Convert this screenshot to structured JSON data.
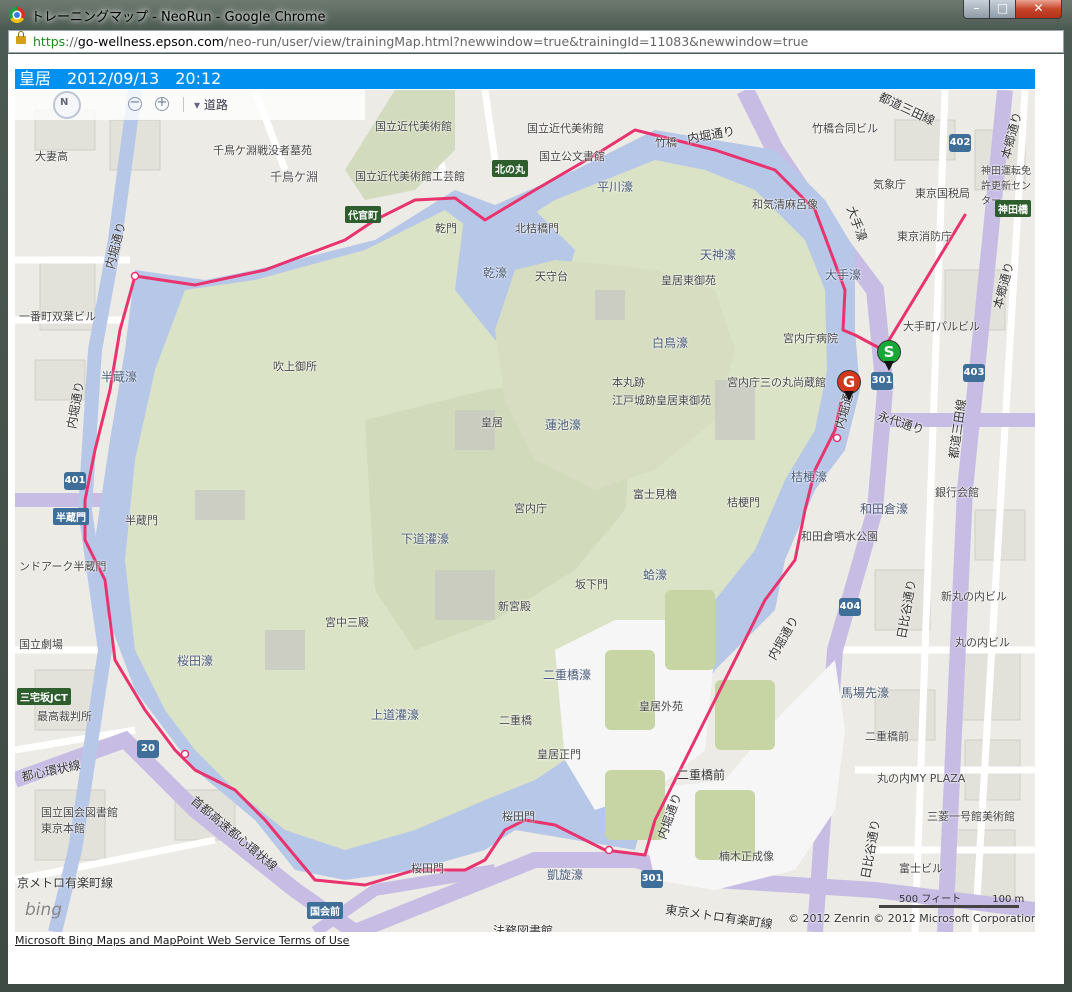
{
  "window": {
    "title": "トレーニングマップ - NeoRun - Google Chrome",
    "minimize": "–",
    "maximize": "□",
    "close": "✕"
  },
  "addressbar": {
    "scheme": "https",
    "host": "go-wellness.epson.com",
    "path": "/neo-run/user/view/trainingMap.html?newwindow=true&trainingId=11083&newwindow=true"
  },
  "header": {
    "title": "皇居　2012/09/13　20:12"
  },
  "map_controls": {
    "compass_label": "N",
    "zoom_out": "−",
    "zoom_in": "+",
    "map_style": "道路"
  },
  "markers": {
    "start": "S",
    "goal": "G"
  },
  "route_color": "#e8336f",
  "map_labels": {
    "chidorigafuchi": "千鳥ケ淵",
    "chidorigafuchi_cemetery": "千鳥ケ淵戦没者墓苑",
    "museum_crafts": "国立近代美術館工芸館",
    "museum_modern": "国立近代美術館",
    "archives": "国立公文書館",
    "takebashi": "竹橋",
    "uchibori_top": "内堀通り",
    "hirakawabori": "平川濠",
    "kitahanebashi": "北桔橋門",
    "inuimon": "乾門",
    "inuibori": "乾濠",
    "tenshudai": "天守台",
    "tenjinbori": "天神濠",
    "higashigyoen": "皇居東御苑",
    "hakuchobori": "白鳥濠",
    "hommaru": "本丸跡",
    "edojo_park": "江戸城跡皇居東御苑",
    "kunaicho_hospital": "宮内庁病院",
    "sannomaru": "宮内庁三の丸尚蔵館",
    "otebori": "大手濠",
    "wakeikai": "和気清麻呂像",
    "kishodai": "気象庁",
    "tokyo_tax": "東京国税局",
    "fire_dept": "東京消防庁",
    "otemachi_bldg": "大手町パルビル",
    "hanzobori": "半蔵濠",
    "fukiage": "吹上御所",
    "kokyo": "皇居",
    "hasuikebori": "蓮池濠",
    "kunaicho": "宮内庁",
    "fujimiyagura": "富士見櫓",
    "kikyomon": "桔梗門",
    "kikyobori": "桔梗濠",
    "wadakurabori": "和田倉濠",
    "wadakura_park": "和田倉噴水公園",
    "hanzomon": "半蔵門",
    "shimomichikanbori": "下道灌濠",
    "shinkyuden": "新宮殿",
    "sakashitamon": "坂下門",
    "hasuike_gate": "蛤濠",
    "kyuchu_sanden": "宮中三殿",
    "sakuradabori": "桜田濠",
    "kamimichikanbori": "上道灌濠",
    "nijubashibori": "二重橋濠",
    "nijubashi": "二重橋",
    "kokyogaien": "皇居外苑",
    "kokyo_seimon": "皇居正門",
    "babasakibori": "馬場先濠",
    "nijubashimae": "二重橋前",
    "marunouchi_myplaza": "丸の内MY PLAZA",
    "mitsubishi_museum": "三菱一号館美術館",
    "kusunoki": "楠木正成像",
    "sakuradamon_top": "桜田門",
    "sakuradamon": "桜田門",
    "gaisenbori": "凱旋濠",
    "ndl": "国立国会図書館 東京本館",
    "supreme_court": "最高裁判所",
    "national_theatre": "国立劇場",
    "kokkaimae": "国会前",
    "shuto_loop": "首都高速都心環状線",
    "toshin_loop": "都心環状線",
    "yurakucho_line": "東京メトロ有楽町線",
    "yurakucho_line2": "京メトロ有楽町線",
    "miyakezaka": "三宅坂JCT",
    "hanzomon_sign": "半蔵門",
    "jimbocho_sign": "神田橋",
    "daikancho": "代官町",
    "kitanomaru": "北の丸",
    "uchibori_left": "内堀通り",
    "uchibori_right": "内堀通り",
    "uchibori_right2": "内堀通り",
    "uchibori_bottom": "内堀通り",
    "eitai": "永代通り",
    "hibiya_1": "日比谷通り",
    "hibiya_2": "日比谷通り",
    "toto_3": "都道三田線",
    "toto_top": "都道三田線",
    "hongo": "本郷通り",
    "hongo2": "本郷通り",
    "gin": "銀行会館",
    "shinmaru": "新丸の内ビル",
    "marunouchi": "丸の内ビル",
    "nijubashi_st": "二重橋前",
    "fuji_bldg": "富士ビル",
    "banchosha": "一番町双葉ビル",
    "arcade": "ンドアーク半蔵門",
    "oumae": "大妻高",
    "takebashi_godo": "竹橋合同ビル",
    "hosei": "法務図書館",
    "kanda": "神田運転免許更新センター",
    "hw_20": "20",
    "hw_401": "401",
    "hw_402": "402",
    "hw_403": "403",
    "hw_404": "404",
    "hw_301a": "301",
    "hw_301b": "301"
  },
  "scale": {
    "left": "500 フィート",
    "right": "100 m"
  },
  "bing": "bing",
  "copyright": "© 2012 Zenrin  © 2012 Microsoft Corporation",
  "terms": "Microsoft Bing Maps and MapPoint Web Service Terms of Use"
}
